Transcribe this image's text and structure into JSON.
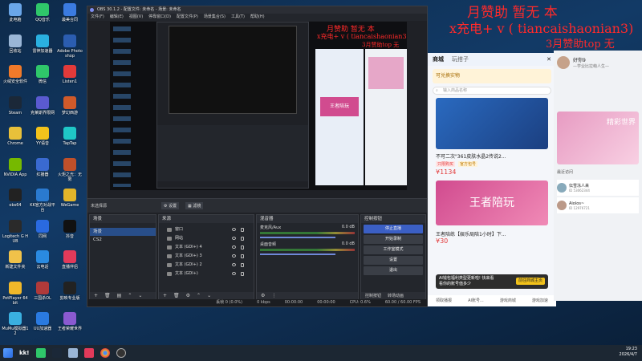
{
  "desktop_icons": [
    {
      "label": "此电脑",
      "color": "#6aa6e8"
    },
    {
      "label": "QQ音乐",
      "color": "#2fc76a"
    },
    {
      "label": "最美合同",
      "color": "#3b7be0"
    },
    {
      "label": "回收站",
      "color": "#9ab6d6"
    },
    {
      "label": "雷神加速器",
      "color": "#2ab0e0"
    },
    {
      "label": "Adobe Photoshop",
      "color": "#2b5db0"
    },
    {
      "label": "火绒安全软件",
      "color": "#f07a2a"
    },
    {
      "label": "微信",
      "color": "#2fc76a"
    },
    {
      "label": "Listen1",
      "color": "#e23a3a"
    },
    {
      "label": "Steam",
      "color": "#1b2838"
    },
    {
      "label": "克莱斯界限网",
      "color": "#5a5ad0"
    },
    {
      "label": "梦幻西游",
      "color": "#d05a2a"
    },
    {
      "label": "Chrome",
      "color": "#e8c03a"
    },
    {
      "label": "YY语音",
      "color": "#f2c21b"
    },
    {
      "label": "TapTap",
      "color": "#1fc7c7"
    },
    {
      "label": "NVIDIA App",
      "color": "#76b900"
    },
    {
      "label": "红播器",
      "color": "#3a6ad0"
    },
    {
      "label": "火炬之光：无限",
      "color": "#c0502a"
    },
    {
      "label": "obs64",
      "color": "#222"
    },
    {
      "label": "KK官方对战平台",
      "color": "#2a7ad0"
    },
    {
      "label": "WeGame",
      "color": "#e2b52a"
    },
    {
      "label": "Logitech G HUB",
      "color": "#2a2a2a"
    },
    {
      "label": "同网",
      "color": "#2a6ae0"
    },
    {
      "label": "抖音",
      "color": "#111"
    },
    {
      "label": "新建文件夹",
      "color": "#f0c24a"
    },
    {
      "label": "云电话",
      "color": "#2a8ae0"
    },
    {
      "label": "直播伴侣",
      "color": "#e23a5a"
    },
    {
      "label": "PotPlayer 64 bit",
      "color": "#f0b82a"
    },
    {
      "label": "三国杀OL",
      "color": "#b03a3a"
    },
    {
      "label": "剪映专业版",
      "color": "#222"
    },
    {
      "label": "MuMu模拟器12",
      "color": "#3ab0e0"
    },
    {
      "label": "UU加速器",
      "color": "#2a7ae0"
    },
    {
      "label": "王者荣耀世界",
      "color": "#8a5ad0"
    }
  ],
  "overlay": {
    "line1": "月赞助   暂无    本",
    "line2": "x充电+ v ( tiancaishaonian3)",
    "line3": "3月赞助top  无"
  },
  "obs": {
    "title": "OBS 30.1.2 - 配置文件: 未命名 - 场景: 未命名",
    "menu": [
      "文件(F)",
      "编辑(E)",
      "视图(V)",
      "停靠窗口(D)",
      "配置文件(P)",
      "场景集合(S)",
      "工具(T)",
      "帮助(H)"
    ],
    "toolbar": {
      "scene_label": "未选择源",
      "settings": "设置",
      "filters": "滤镜"
    },
    "scenes": {
      "header": "场景",
      "items": [
        "场景",
        "CS2"
      ]
    },
    "sources": {
      "header": "来源",
      "items": [
        "窗口",
        "网站",
        "文本 (GDI+) 4",
        "文本 (GDI+) 3",
        "文本 (GDI+) 2",
        "文本 (GDI+)"
      ]
    },
    "mixer": {
      "header": "混音器",
      "channels": [
        {
          "name": "麦克风/Aux",
          "db": "0.0 dB"
        },
        {
          "name": "桌面音频",
          "db": "0.0 dB"
        }
      ]
    },
    "controls": {
      "header": "控制按钮",
      "buttons": [
        "停止直播",
        "开始录制",
        "工作室模式",
        "设置",
        "退出"
      ],
      "tabs": [
        "控制按钮",
        "转场动画"
      ]
    },
    "status": {
      "frames": "丢帧 0 (0.0%)",
      "bitrate": "0 kbps",
      "rec_time": "00:00:00",
      "live_time": "00:00:00",
      "cpu": "CPU: 0.6%",
      "fps": "60.00 / 60.00 FPS"
    }
  },
  "app_mid": {
    "tabs": [
      "商城",
      "玩搭子"
    ],
    "search_placeholder": "输入商品名称",
    "banner_text": "可兑换实物",
    "price1": "¥1134",
    "item1": "不可二次\"361皮肤水晶2传说2...",
    "tags": [
      "只限购买",
      "官方包号"
    ],
    "price2": "¥1134",
    "banner2": "王者陪玩",
    "item2": "王者陪练【娱乐局陪1小时】下...",
    "price3": "¥30",
    "popup": "AI钱包福利类型更新啦! 快来看看你的账号值多少",
    "popup_btn": "前往商城主页",
    "bottom_nav": [
      "领取播报",
      "AI账号...",
      "游戏商城",
      "游戏加速"
    ]
  },
  "app_right": {
    "user_name": "好你9",
    "user_sub": "—学业比拉萌人生—",
    "banner": "精彩世界",
    "list": [
      {
        "name": "伝雪冻人来",
        "id": "ID 53062344"
      },
      {
        "name": "Aiolos~",
        "id": "ID 12976721"
      }
    ],
    "misc": "最近访问"
  },
  "taskbar": {
    "start_label": "kk!",
    "time": "19:23",
    "date": "2026/4/7"
  }
}
